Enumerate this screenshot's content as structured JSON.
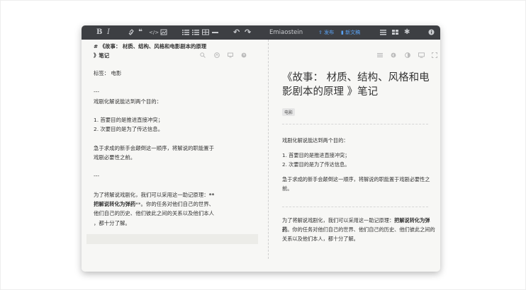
{
  "toolbar": {
    "bold": "B",
    "italic": "I",
    "brand": "Emiaostein",
    "publish": "发布",
    "new_article": "新文稿"
  },
  "editor": {
    "title_line1": "# 《故事： 材质、结构、风格和电影剧本的原理",
    "title_line2": "》笔记",
    "tags": "标签： 电影",
    "hr1": "---",
    "intro": "戏剧化解说能达到两个目的：",
    "list1": "1. 首要目的是推进直接冲突；",
    "list2": "2. 次要目的是为了传达信息。",
    "para1_line1": "急于求成的新手会颠倒这一顺序，将解说的职能置于",
    "para1_line2": "戏剧必要性之前。",
    "hr2": "---",
    "para2_line1_a": "为了将解说戏剧化，我们可以采用这一助记原理：",
    "para2_line1_b": "**",
    "para2_line2_a": "把解说转化为弹药",
    "para2_line2_b": "**。你的任务对他们自己的世界、",
    "para2_line3": "他们自己的历史、他们彼此之间的关系以及他们本人",
    "para2_line4": "，都十分了解。"
  },
  "preview": {
    "title": "《故事： 材质、结构、风格和电影剧本的原理 》笔记",
    "tag": "电影",
    "intro": "戏剧化解说能达到两个目的：",
    "list1": "1. 首要目的是推进直接冲突；",
    "list2": "2. 次要目的是为了传达信息。",
    "para1": "急于求成的新手会颠倒这一顺序，将解说的职能置于戏剧必要性之前。",
    "para2_a": "为了将解说戏剧化，我们可以采用这一助记原理：",
    "para2_bold": "把解说转化为弹药",
    "para2_b": "。你的任务对他们自己的世界、他们自己的历史、他们彼此之间的关系以及他们本人，都十分了解。"
  },
  "colors": {
    "toolbar_bg": "#3d3f43",
    "accent_blue": "#5aa3f5",
    "editor_bg": "#f7f7f5"
  },
  "icons": [
    "bold",
    "italic",
    "link-icon",
    "quote-icon",
    "code-icon",
    "image-icon",
    "bulleted-list-icon",
    "numbered-list-icon",
    "table-icon",
    "horizontal-rule-icon",
    "undo-icon",
    "redo-icon",
    "publish-icon",
    "new-article-icon",
    "menu-icon",
    "grid-icon",
    "gear-icon",
    "info-icon",
    "search-icon",
    "upload-icon",
    "monitor-icon",
    "help-icon",
    "list-view-icon",
    "circle-icon",
    "half-circle-icon",
    "desktop-icon",
    "fullscreen-icon"
  ]
}
